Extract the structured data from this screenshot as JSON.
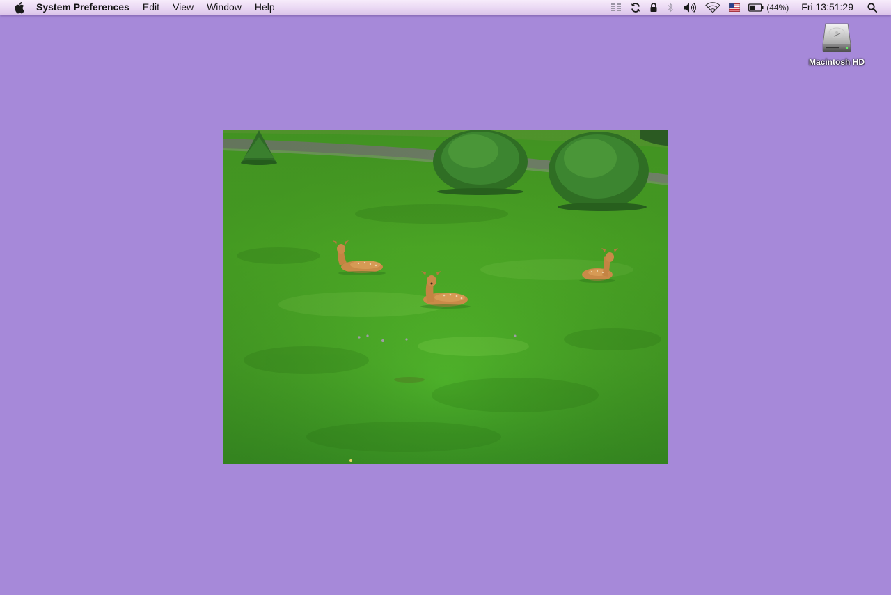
{
  "menubar": {
    "apple_icon": "apple-logo-icon",
    "app_name": "System Preferences",
    "menus": [
      "Edit",
      "View",
      "Window",
      "Help"
    ],
    "status_icons": [
      "spaces-icon",
      "sync-icon",
      "lock-icon",
      "bluetooth-icon",
      "volume-icon",
      "wifi-icon",
      "us-flag-input-icon",
      "battery-icon"
    ],
    "battery_percent": "(44%)",
    "clock": "Fri 13:51:29",
    "spotlight_icon": "spotlight-search-icon"
  },
  "desktop": {
    "background_color": "#a689d9",
    "drive": {
      "icon": "hard-drive-icon",
      "label": "Macintosh HD"
    },
    "photo": {
      "icon": "desktop-picture-fawns-in-grass"
    }
  }
}
